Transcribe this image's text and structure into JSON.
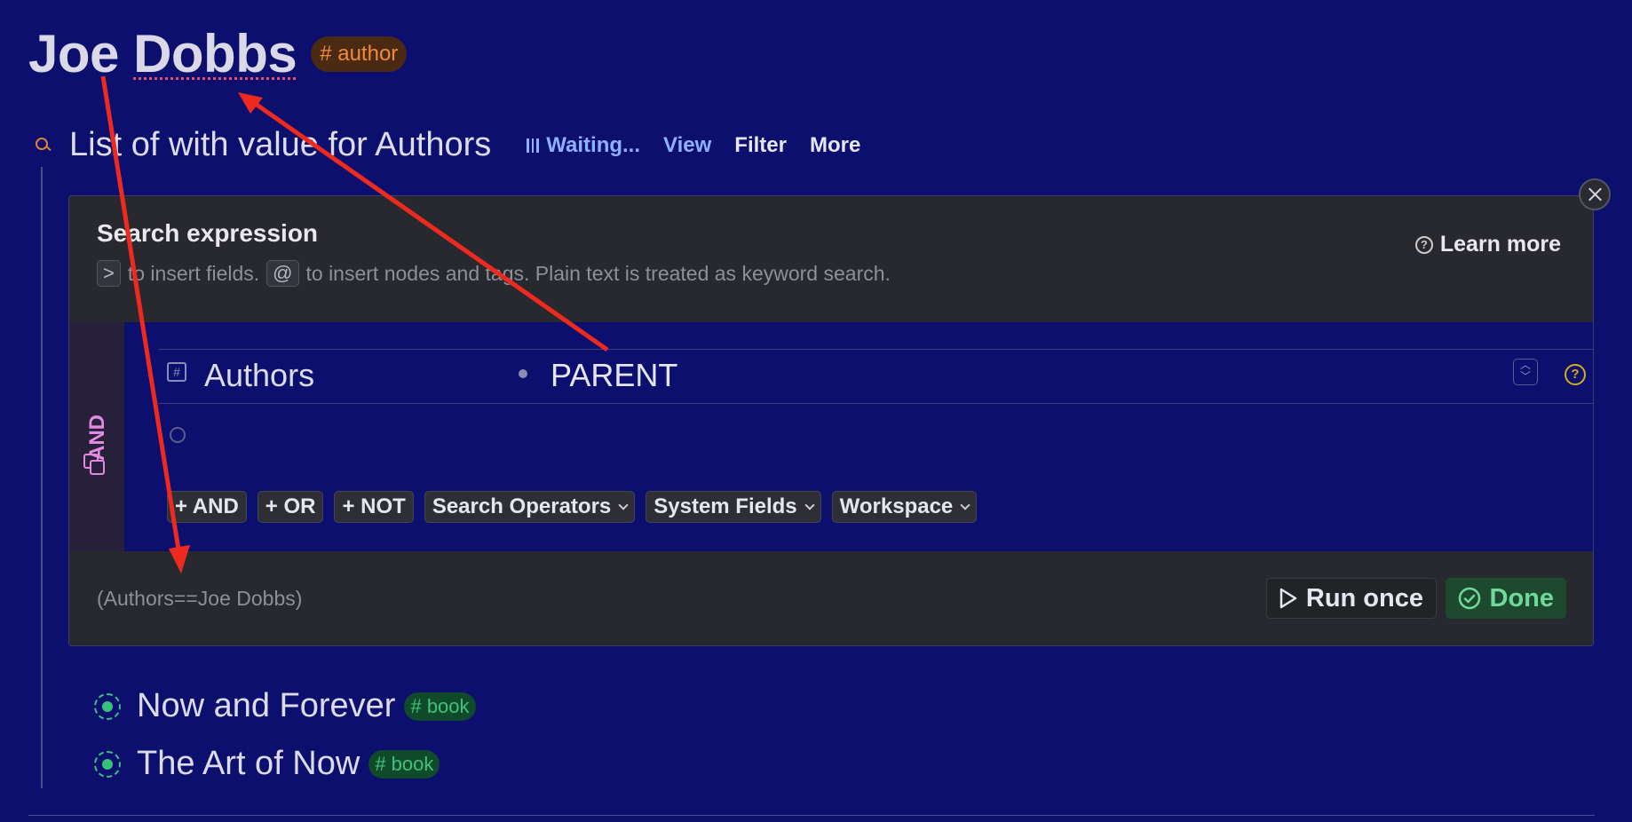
{
  "header": {
    "title_first": "Joe",
    "title_second": "Dobbs",
    "tag": "# author"
  },
  "search": {
    "title": "List of with value for Authors",
    "status": "Waiting...",
    "view_label": "View",
    "filter_label": "Filter",
    "more_label": "More"
  },
  "panel": {
    "heading": "Search expression",
    "hint_key1": ">",
    "hint_text1": "to insert fields.",
    "hint_key2": "@",
    "hint_text2": "to insert nodes and tags. Plain text is treated as keyword search.",
    "learn_more": "Learn more",
    "logic_label": "AND",
    "field_name": "Authors",
    "field_value": "PARENT",
    "operators": {
      "and": "+ AND",
      "or": "+ OR",
      "not": "+ NOT",
      "search_ops": "Search Operators",
      "system_fields": "System Fields",
      "workspace": "Workspace"
    },
    "expression": "(Authors==Joe Dobbs)",
    "run_once": "Run once",
    "done": "Done"
  },
  "results": [
    {
      "title": "Now and Forever",
      "tag": "# book"
    },
    {
      "title": "The Art of Now",
      "tag": "# book"
    }
  ],
  "colors": {
    "background": "#0c0f6e",
    "annotation_arrow": "#ee2a1e",
    "author_tag": "#f08a3c",
    "book_tag": "#3fc27a",
    "and_label": "#e38ae0"
  }
}
